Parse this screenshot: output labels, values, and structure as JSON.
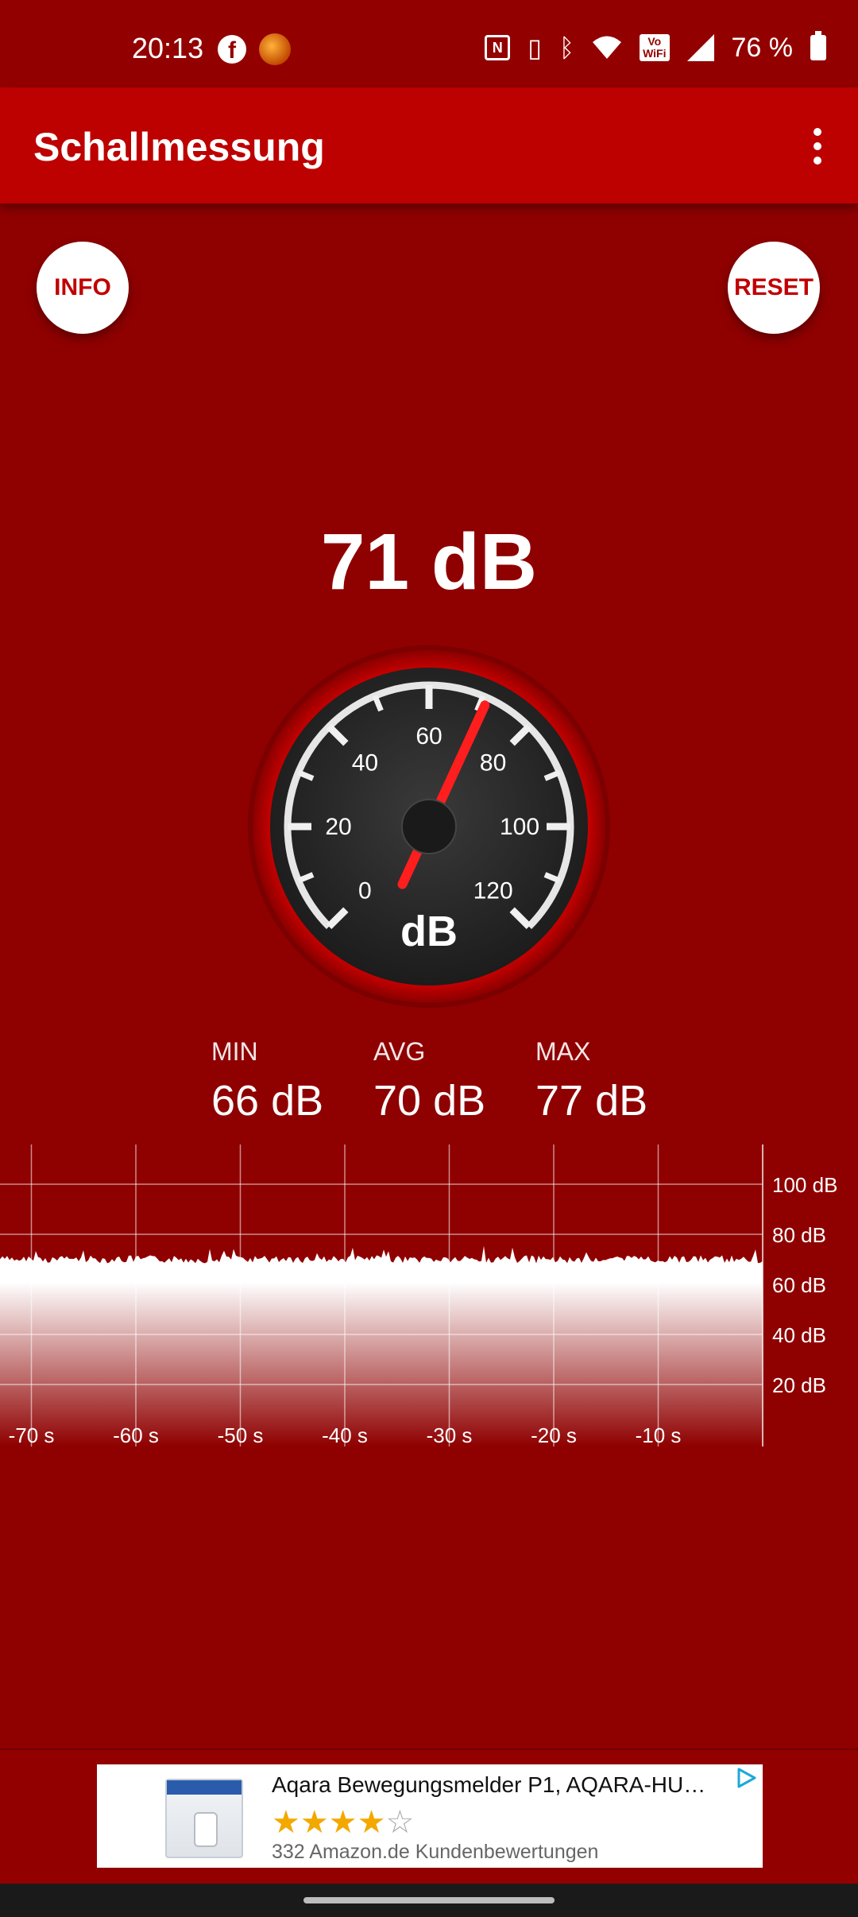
{
  "status_bar": {
    "time": "20:13",
    "battery": "76 %",
    "icons": [
      "facebook-icon",
      "game-app-icon",
      "nfc-icon",
      "vibrate-icon",
      "bluetooth-icon",
      "wifi-icon",
      "vowifi-icon",
      "signal-icon",
      "battery-icon"
    ]
  },
  "app_bar": {
    "title": "Schallmessung",
    "menu_icon": "more-vert-icon"
  },
  "buttons": {
    "info": "INFO",
    "reset": "RESET"
  },
  "current": {
    "value_text": "71 dB",
    "value": 71
  },
  "gauge": {
    "unit": "dB",
    "labels": [
      "0",
      "20",
      "40",
      "60",
      "80",
      "100",
      "120"
    ],
    "min": 0,
    "max": 120,
    "needle_value": 71,
    "colors": {
      "face": "#2b2b2b",
      "ring": "#d40000",
      "needle": "#ff1e1e",
      "ticks": "#ffffff"
    }
  },
  "stats": {
    "min": {
      "label": "MIN",
      "value": "66 dB"
    },
    "avg": {
      "label": "AVG",
      "value": "70 dB"
    },
    "max": {
      "label": "MAX",
      "value": "77 dB"
    }
  },
  "history_graph": {
    "y_labels": [
      "100 dB",
      "80 dB",
      "60 dB",
      "40 dB",
      "20 dB"
    ],
    "x_labels": [
      "-70 s",
      "-60 s",
      "-50 s",
      "-40 s",
      "-30 s",
      "-20 s",
      "-10 s"
    ],
    "level_db": 70
  },
  "ad": {
    "title": "Aqara Bewegungsmelder P1, AQARA-HUB…",
    "rating_stars": 4,
    "rating_max": 5,
    "reviews": "332 Amazon.de Kundenbewertungen",
    "ad_choices_color": "#1fa8d6"
  },
  "theme": {
    "background": "#8f0000",
    "app_bar": "#bd0000",
    "accent": "#c00000"
  }
}
